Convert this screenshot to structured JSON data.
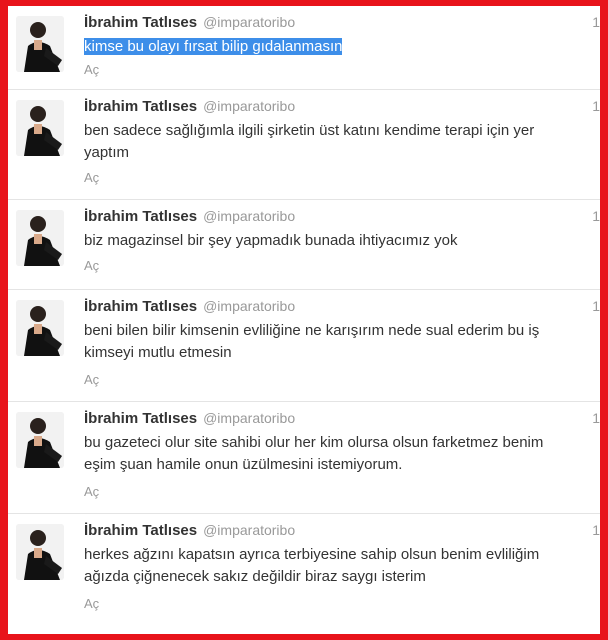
{
  "tweets": [
    {
      "name": "İbrahim Tatlıses",
      "handle": "@imparatoribo",
      "time": "1",
      "lines": [
        "kimse bu olayı fırsat bilip gıdalanmasın"
      ],
      "expand": "Aç",
      "selected": true
    },
    {
      "name": "İbrahim Tatlıses",
      "handle": "@imparatoribo",
      "time": "1",
      "lines": [
        "ben sadece sağlığımla ilgili şirketin üst katını kendime terapi için yer",
        "yaptım"
      ],
      "expand": "Aç"
    },
    {
      "name": "İbrahim Tatlıses",
      "handle": "@imparatoribo",
      "time": "1",
      "lines": [
        "biz magazinsel bir şey yapmadık bunada ihtiyacımız yok"
      ],
      "expand": "Aç"
    },
    {
      "name": "İbrahim Tatlıses",
      "handle": "@imparatoribo",
      "time": "1",
      "lines": [
        "beni bilen bilir kimsenin evliliğine ne karışırım nede sual ederim bu iş",
        "kimseyi mutlu etmesin"
      ],
      "expand": "Aç"
    },
    {
      "name": "İbrahim Tatlıses",
      "handle": "@imparatoribo",
      "time": "1",
      "lines": [
        "bu gazeteci olur site sahibi olur her kim olursa olsun farketmez benim",
        "eşim şuan hamile onun üzülmesini istemiyorum."
      ],
      "expand": "Aç"
    },
    {
      "name": "İbrahim Tatlıses",
      "handle": "@imparatoribo",
      "time": "1",
      "lines": [
        "herkes ağzını kapatsın ayrıca terbiyesine sahip olsun benim evliliğim",
        "ağızda çiğnenecek sakız değildir biraz saygı isterim"
      ],
      "expand": "Aç"
    }
  ]
}
